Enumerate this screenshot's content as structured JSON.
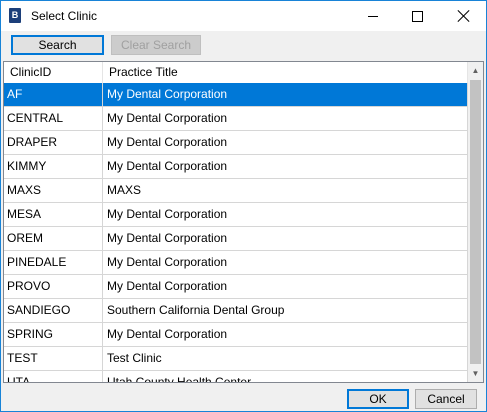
{
  "window": {
    "title": "Select Clinic",
    "icon": "app-icon",
    "controls": [
      "minimize-icon",
      "maximize-icon",
      "close-icon"
    ]
  },
  "toolbar": {
    "search_label": "Search",
    "clear_search_label": "Clear Search"
  },
  "grid": {
    "columns": [
      "ClinicID",
      "Practice Title"
    ],
    "selected_index": 0,
    "rows": [
      {
        "id": "AF",
        "title": "My Dental Corporation"
      },
      {
        "id": "CENTRAL",
        "title": "My Dental Corporation"
      },
      {
        "id": "DRAPER",
        "title": "My Dental Corporation"
      },
      {
        "id": "KIMMY",
        "title": "My Dental Corporation"
      },
      {
        "id": "MAXS",
        "title": "MAXS"
      },
      {
        "id": "MESA",
        "title": "My Dental Corporation"
      },
      {
        "id": "OREM",
        "title": "My Dental Corporation"
      },
      {
        "id": "PINEDALE",
        "title": "My Dental Corporation"
      },
      {
        "id": "PROVO",
        "title": "My Dental Corporation"
      },
      {
        "id": "SANDIEGO",
        "title": "Southern California Dental Group"
      },
      {
        "id": "SPRING",
        "title": "My Dental Corporation"
      },
      {
        "id": "TEST",
        "title": "Test Clinic"
      },
      {
        "id": "UTA",
        "title": "Utah County Health Center"
      }
    ]
  },
  "footer": {
    "ok_label": "OK",
    "cancel_label": "Cancel"
  },
  "colors": {
    "selection": "#0078d7",
    "window_border": "#1883d7"
  }
}
